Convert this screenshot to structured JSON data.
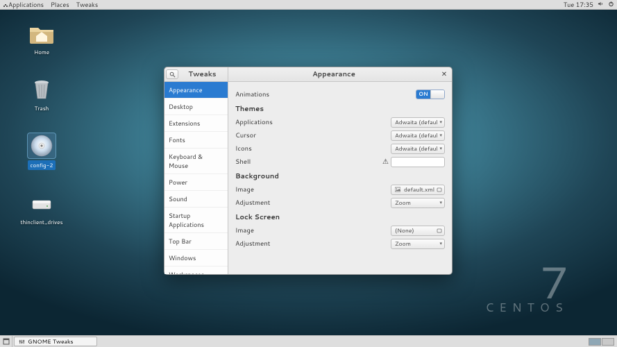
{
  "topbar": {
    "menus": [
      "Applications",
      "Places",
      "Tweaks"
    ],
    "clock": "Tue 17:35"
  },
  "desktop_icons": [
    {
      "id": "home",
      "label": "Home",
      "kind": "folder-home"
    },
    {
      "id": "trash",
      "label": "Trash",
      "kind": "trash"
    },
    {
      "id": "config2",
      "label": "config-2",
      "kind": "disc",
      "selected": true
    },
    {
      "id": "thinclient",
      "label": "thinclient_drives",
      "kind": "drive"
    }
  ],
  "watermark": {
    "big": "7",
    "text": "CENTOS"
  },
  "taskbar": {
    "active_task": "GNOME Tweaks"
  },
  "window": {
    "left_title": "Tweaks",
    "title": "Appearance",
    "sidebar": [
      "Appearance",
      "Desktop",
      "Extensions",
      "Fonts",
      "Keyboard & Mouse",
      "Power",
      "Sound",
      "Startup Applications",
      "Top Bar",
      "Windows",
      "Workspaces"
    ],
    "sidebar_selected": 0,
    "content": {
      "animations_label": "Animations",
      "animations_on": "ON",
      "sections": {
        "themes": {
          "heading": "Themes",
          "applications": {
            "label": "Applications",
            "value": "Adwaita (default)"
          },
          "cursor": {
            "label": "Cursor",
            "value": "Adwaita (default)"
          },
          "icons": {
            "label": "Icons",
            "value": "Adwaita (default)"
          },
          "shell": {
            "label": "Shell",
            "warning": "⚠"
          }
        },
        "background": {
          "heading": "Background",
          "image": {
            "label": "Image",
            "value": "default.xml"
          },
          "adjustment": {
            "label": "Adjustment",
            "value": "Zoom"
          }
        },
        "lockscreen": {
          "heading": "Lock Screen",
          "image": {
            "label": "Image",
            "value": "(None)"
          },
          "adjustment": {
            "label": "Adjustment",
            "value": "Zoom"
          }
        }
      }
    }
  }
}
